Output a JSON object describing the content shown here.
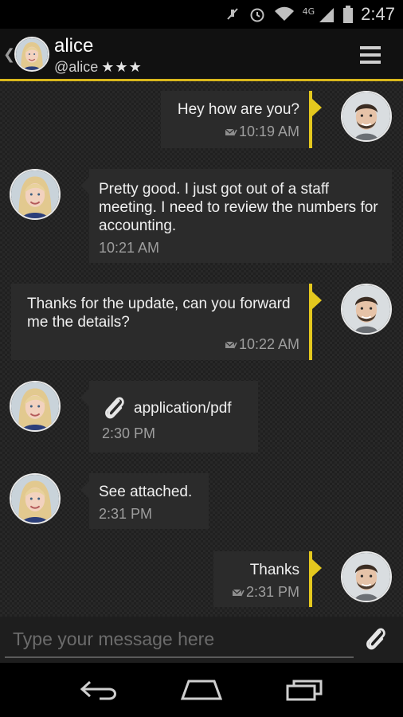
{
  "status_bar": {
    "network": "4G",
    "time": "2:47"
  },
  "contact": {
    "name": "alice",
    "handle": "@alice",
    "stars": "★★★"
  },
  "messages": [
    {
      "direction": "out",
      "text": "Hey how are you?",
      "time": "10:19 AM"
    },
    {
      "direction": "in",
      "text": "Pretty good. I just got out of a staff meeting. I need to review the numbers for accounting.",
      "time": "10:21 AM"
    },
    {
      "direction": "out",
      "text": "Thanks for the update, can you forward me the details?",
      "time": "10:22 AM"
    },
    {
      "direction": "in",
      "attachment": "application/pdf",
      "time": "2:30 PM"
    },
    {
      "direction": "in",
      "text": "See attached.",
      "time": "2:31 PM"
    },
    {
      "direction": "out",
      "text": "Thanks",
      "time": "2:31 PM"
    }
  ],
  "composer": {
    "placeholder": "Type your message here"
  },
  "icons": {
    "back": "chevron-left-icon",
    "menu": "hamburger-icon",
    "attach": "paperclip-icon",
    "sent": "sent-check-icon",
    "nav_back": "back-icon",
    "nav_home": "home-icon",
    "nav_recent": "recents-icon"
  },
  "colors": {
    "accent": "#e4c81e",
    "bubble": "#2b2b2b",
    "background": "#202020"
  }
}
